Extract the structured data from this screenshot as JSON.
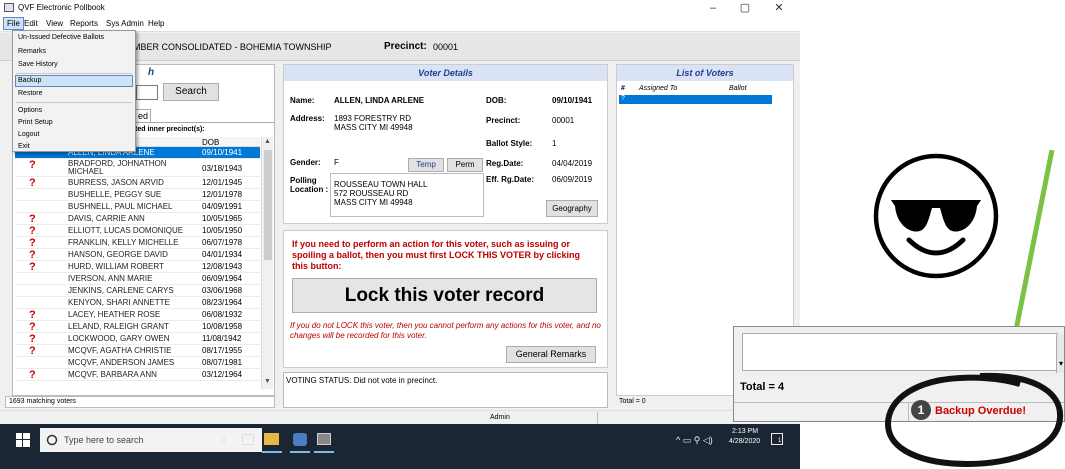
{
  "window": {
    "title": "QVF Electronic Pollbook",
    "min": "–",
    "max": "▢",
    "close": "✕"
  },
  "menu": {
    "items": [
      "File",
      "Edit",
      "View",
      "Reports",
      "Sys Admin",
      "Help"
    ],
    "file_menu": [
      "Un-Issued Defective Ballots",
      "Remarks",
      "Save History",
      "Backup",
      "Restore",
      "Options",
      "Print Setup",
      "Logout",
      "Exit"
    ]
  },
  "header": {
    "jurisdiction_fragment": "MBER CONSOLIDATED - BOHEMIA TOWNSHIP",
    "precinct_label": "Precinct:",
    "precinct_value": "00001"
  },
  "search": {
    "title_fragment": "h",
    "button": "Search",
    "tab_fragment": "ed",
    "subtitle_fragment": "ted inner precinct(s):",
    "col_dob": "DOB",
    "rows": [
      {
        "flag": "",
        "name": "ALLEN, LINDA ARLENE",
        "dob": "09/10/1941"
      },
      {
        "flag": "?",
        "name": "BRADFORD, JOHNATHON MICHAEL",
        "dob": "03/18/1943"
      },
      {
        "flag": "?",
        "name": "BURRESS, JASON ARVID",
        "dob": "12/01/1945"
      },
      {
        "flag": "",
        "name": "BUSHELLE, PEGGY SUE",
        "dob": "12/01/1978"
      },
      {
        "flag": "",
        "name": "BUSHNELL, PAUL MICHAEL",
        "dob": "04/09/1991"
      },
      {
        "flag": "?",
        "name": "DAVIS, CARRIE ANN",
        "dob": "10/05/1965"
      },
      {
        "flag": "?",
        "name": "ELLIOTT, LUCAS DOMONIQUE",
        "dob": "10/05/1950"
      },
      {
        "flag": "?",
        "name": "FRANKLIN, KELLY MICHELLE",
        "dob": "06/07/1978"
      },
      {
        "flag": "?",
        "name": "HANSON, GEORGE DAVID",
        "dob": "04/01/1934"
      },
      {
        "flag": "?",
        "name": "HURD, WILLIAM ROBERT",
        "dob": "12/08/1943"
      },
      {
        "flag": "",
        "name": "IVERSON, ANN MARIE",
        "dob": "06/09/1964"
      },
      {
        "flag": "",
        "name": "JENKINS, CARLENE CARYS",
        "dob": "03/06/1968"
      },
      {
        "flag": "",
        "name": "KENYON, SHARI ANNETTE",
        "dob": "08/23/1964"
      },
      {
        "flag": "?",
        "name": "LACEY, HEATHER ROSE",
        "dob": "06/08/1932"
      },
      {
        "flag": "?",
        "name": "LELAND, RALEIGH GRANT",
        "dob": "10/08/1958"
      },
      {
        "flag": "?",
        "name": "LOCKWOOD, GARY OWEN",
        "dob": "11/08/1942"
      },
      {
        "flag": "?",
        "name": "MCQVF, AGATHA  CHRISTIE",
        "dob": "08/17/1955"
      },
      {
        "flag": "",
        "name": "MCQVF, ANDERSON JAMES",
        "dob": "08/07/1981"
      },
      {
        "flag": "?",
        "name": "MCQVF, BARBARA  ANN",
        "dob": "03/12/1964"
      }
    ],
    "status": "1693 matching voters"
  },
  "details": {
    "title": "Voter Details",
    "name_label": "Name:",
    "name": "ALLEN, LINDA ARLENE",
    "dob_label": "DOB:",
    "dob": "09/10/1941",
    "address_label": "Address:",
    "address1": "1893 FORESTRY RD",
    "address2": "MASS CITY MI 49948",
    "precinct_label": "Precinct:",
    "precinct": "00001",
    "ballot_style_label": "Ballot Style:",
    "ballot_style": "1",
    "gender_label": "Gender:",
    "gender": "F",
    "temp_button": "Temp",
    "perm_button": "Perm",
    "regdate_label": "Reg.Date:",
    "regdate": "04/04/2019",
    "effdate_label": "Eff. Rg.Date:",
    "effdate": "06/09/2019",
    "polling_label1": "Polling",
    "polling_label2": "Location :",
    "polling1": "ROUSSEAU TOWN HALL",
    "polling2": "572 ROUSSEAU RD",
    "polling3": "MASS CITY MI 49948",
    "geography_button": "Geography"
  },
  "lock": {
    "warning": "If you need to perform an action for this voter, such as issuing or spoiling a ballot, then you must first LOCK THIS VOTER by clicking this button:",
    "button": "Lock this voter record",
    "note": "If you do not LOCK this voter, then you cannot perform any actions for this voter, and no changes will be recorded for this voter.",
    "remarks_button": "General Remarks"
  },
  "voting_status": "VOTING STATUS: Did not vote in precinct.",
  "list": {
    "title": "List of Voters",
    "col_num": "#",
    "col_assigned": "Assigned To",
    "col_ballot": "Ballot",
    "row_marker": "?",
    "total": "Total = 0"
  },
  "statusbar": {
    "user": "Admin"
  },
  "taskbar": {
    "search_placeholder": "Type here to search",
    "time": "2:13 PM",
    "date": "4/28/2020"
  },
  "inset": {
    "total": "Total = 4",
    "badge": "1",
    "alert": "Backup Overdue!"
  },
  "colors": {
    "accent": "#0078d7",
    "alert_red": "#cc0000",
    "arrow_green": "#7cc242",
    "panel_title": "#1f3e8c"
  }
}
